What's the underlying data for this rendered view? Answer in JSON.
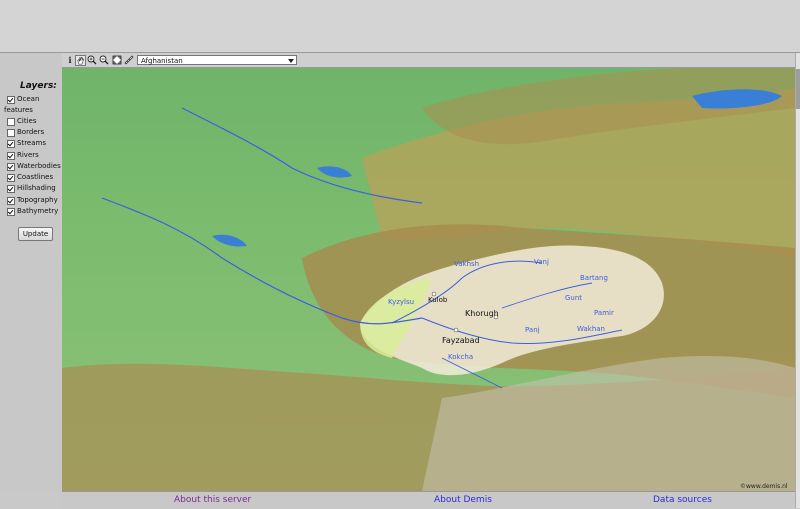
{
  "sidebar": {
    "title": "Layers:",
    "layers": [
      {
        "label": "Ocean",
        "checked": true
      },
      {
        "label": "features",
        "checked": null
      },
      {
        "label": "Cities",
        "checked": false
      },
      {
        "label": "Borders",
        "checked": false
      },
      {
        "label": "Streams",
        "checked": true
      },
      {
        "label": "Rivers",
        "checked": true
      },
      {
        "label": "Waterbodies",
        "checked": true
      },
      {
        "label": "Coastlines",
        "checked": true
      },
      {
        "label": "Hillshading",
        "checked": true
      },
      {
        "label": "Topography",
        "checked": true
      },
      {
        "label": "Bathymetry",
        "checked": true
      }
    ],
    "update_label": "Update"
  },
  "toolbar": {
    "tools": [
      "info-icon",
      "pan-hand-icon",
      "zoom-in-icon",
      "zoom-out-icon",
      "zoom-extent-icon",
      "measure-icon"
    ],
    "select_value": "Afghanistan"
  },
  "map": {
    "places": [
      "Kulob",
      "Khorugh",
      "Fayzabad"
    ],
    "rivers": [
      "Vakhsh",
      "Vanj",
      "Bartang",
      "Kyzylsu",
      "Gunt",
      "Pamir",
      "Panj",
      "Wakhan",
      "Kokcha"
    ],
    "watermark": "©www.demis.nl"
  },
  "footer": {
    "about_server": "About this server",
    "about_demis": "About Demis",
    "data_sources": "Data sources"
  },
  "colors": {
    "link_visited": "#7b2b8f",
    "link": "#2b2bd6",
    "river": "#3c5ee0"
  }
}
